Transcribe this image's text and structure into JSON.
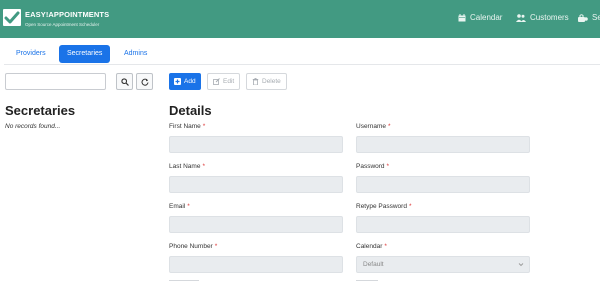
{
  "header": {
    "brand_title": "EASY!APPOINTMENTS",
    "brand_subtitle": "Open Source Appointment Scheduler",
    "nav": [
      {
        "label": "Calendar",
        "icon": "calendar-icon"
      },
      {
        "label": "Customers",
        "icon": "users-icon"
      },
      {
        "label": "Se",
        "icon": "services-icon"
      }
    ],
    "bg_color": "#429a82"
  },
  "tabs": [
    {
      "label": "Providers",
      "active": false
    },
    {
      "label": "Secretaries",
      "active": true
    },
    {
      "label": "Admins",
      "active": false
    }
  ],
  "search": {
    "value": "",
    "placeholder": ""
  },
  "toolbar": {
    "add_label": "Add",
    "edit_label": "Edit",
    "delete_label": "Delete"
  },
  "list": {
    "title": "Secretaries",
    "empty_text": "No records found..."
  },
  "details": {
    "title": "Details",
    "left_fields": [
      {
        "label": "First Name",
        "required": "*"
      },
      {
        "label": "Last Name",
        "required": "*"
      },
      {
        "label": "Email",
        "required": "*"
      },
      {
        "label": "Phone Number",
        "required": "*"
      }
    ],
    "right_fields": [
      {
        "label": "Username",
        "required": "*"
      },
      {
        "label": "Password",
        "required": "*"
      },
      {
        "label": "Retype Password",
        "required": "*"
      },
      {
        "label": "Calendar",
        "required": "*"
      }
    ],
    "calendar_value": "Default"
  },
  "colors": {
    "accent": "#1a73e8",
    "header": "#429a82",
    "required": "#dd3333"
  }
}
